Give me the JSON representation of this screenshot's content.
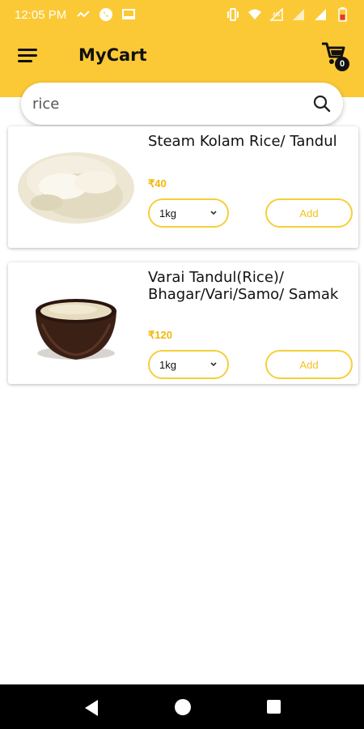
{
  "status_bar": {
    "time": "12:05 PM",
    "icons": [
      "signal-icon",
      "whatsapp-icon",
      "screen-icon",
      "vibrate-icon",
      "wifi-icon",
      "data-icon",
      "cellular-icon",
      "cellular-icon-2",
      "battery-icon"
    ]
  },
  "app_bar": {
    "title": "MyCart",
    "cart_count": "0",
    "background": "#fbc936"
  },
  "search": {
    "value": "rice"
  },
  "products": [
    {
      "name": "Steam Kolam Rice/ Tandul",
      "price": "₹40",
      "quantity": "1kg",
      "add_label": "Add"
    },
    {
      "name": "Varai Tandul(Rice)/ Bhagar/Vari/Samo/ Samak",
      "price": "₹120",
      "quantity": "1kg",
      "add_label": "Add"
    }
  ],
  "colors": {
    "accent": "#fbc936",
    "price": "#f2b705",
    "button_border": "#f5cf3a"
  }
}
